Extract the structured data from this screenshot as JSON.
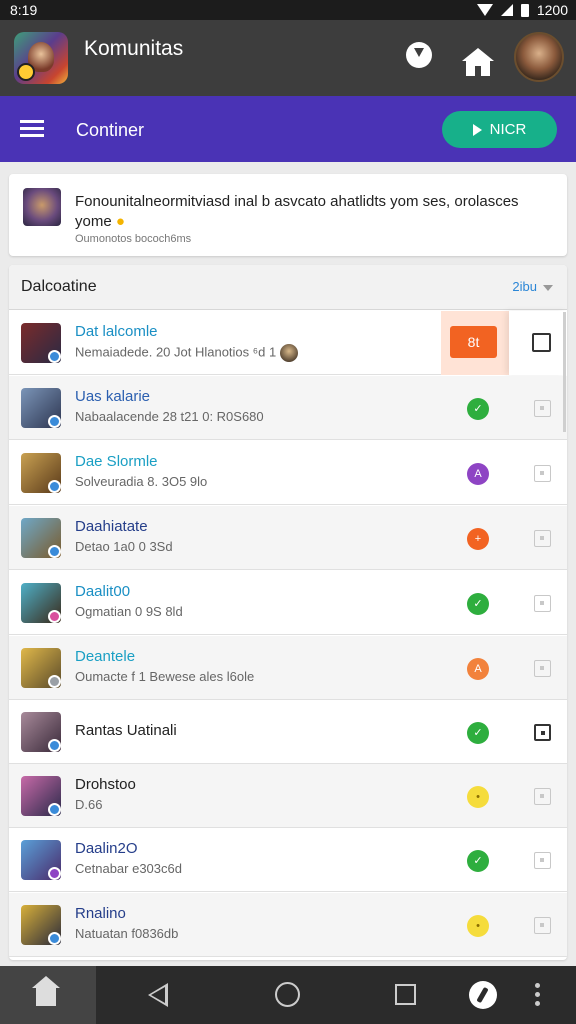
{
  "status_bar": {
    "time": "8:19",
    "battery": "1200"
  },
  "app_bar": {
    "title": "Komunitas"
  },
  "toolbar": {
    "title": "Continer",
    "next_label": "NICR"
  },
  "notice": {
    "text": "Fonounitalneormitviasd inal b asvcato ahatlidts yom ses, orolasces yome",
    "sub": "Oumonotos bococh6ms"
  },
  "list": {
    "header": "Dalcoatine",
    "sort_label": "2ibu",
    "rows": [
      {
        "title": "Dat lalcomle",
        "sub": "Nemaiadede. 20 Jot Hlanotios ⁶d 1",
        "status": "8t",
        "status_color": "#f26322",
        "title_color": "#1a8fc4",
        "thumb": [
          "#7a2b2b",
          "#2a2a44"
        ],
        "badge": "#3a8bd9",
        "checked": false
      },
      {
        "title": "Uas kalarie",
        "sub": "Nabaalacende 28 t21 0: R0S680",
        "status": "✓",
        "status_color": "#2eae3e",
        "title_color": "#2b5fb0",
        "thumb": [
          "#7b95b8",
          "#2d3550"
        ],
        "badge": "#3a8bd9",
        "checked": false
      },
      {
        "title": "Dae Slormle",
        "sub": "Solveuradia 8. 3O5 9lo",
        "status": "A",
        "status_color": "#8e44c4",
        "title_color": "#1a9fc4",
        "thumb": [
          "#c9a152",
          "#5a3a1a"
        ],
        "badge": "#3a8bd9",
        "checked": false
      },
      {
        "title": "Daahiatate",
        "sub": "Detao 1a0 0 3Sd",
        "status": "+",
        "status_color": "#f26322",
        "title_color": "#253e8a",
        "thumb": [
          "#6fa8c8",
          "#7a5a2a"
        ],
        "badge": "#3a8bd9",
        "checked": false
      },
      {
        "title": "Daalit00",
        "sub": "Ogmatian 0 9S 8ld",
        "status": "✓",
        "status_color": "#2eae3e",
        "title_color": "#1a8fc4",
        "thumb": [
          "#4fb0c8",
          "#3a2a1a"
        ],
        "badge": "#d94f9e",
        "checked": false
      },
      {
        "title": "Deantele",
        "sub": "Oumacte f 1 Bewese ales l6ole",
        "status": "A",
        "status_color": "#f2823c",
        "title_color": "#1a9fc4",
        "thumb": [
          "#e0b84a",
          "#5a4a2a"
        ],
        "badge": "#9aa0a6",
        "checked": false
      },
      {
        "title": "Rantas Uatinali",
        "sub": "",
        "status": "✓",
        "status_color": "#2eae3e",
        "title_color": "#222222",
        "thumb": [
          "#a88a9a",
          "#3a2a3a"
        ],
        "badge": "#3a8bd9",
        "checked": true
      },
      {
        "title": "Drohstoo",
        "sub": "D.66",
        "status": "•",
        "status_color": "#f5dc3c",
        "title_color": "#222222",
        "thumb": [
          "#c86aa8",
          "#2a2a4a"
        ],
        "badge": "#3a8bd9",
        "checked": false
      },
      {
        "title": "Daalin2O",
        "sub": "Cetnabar e303c6d",
        "status": "✓",
        "status_color": "#2eae3e",
        "title_color": "#253e8a",
        "thumb": [
          "#5aa0d8",
          "#4a2a6a"
        ],
        "badge": "#8e44c4",
        "checked": false
      },
      {
        "title": "Rnalino",
        "sub": "Natuatan f0836db",
        "status": "•",
        "status_color": "#f5dc3c",
        "title_color": "#253e8a",
        "thumb": [
          "#d8b03a",
          "#2a2a3a"
        ],
        "badge": "#3a8bd9",
        "checked": false
      }
    ]
  }
}
